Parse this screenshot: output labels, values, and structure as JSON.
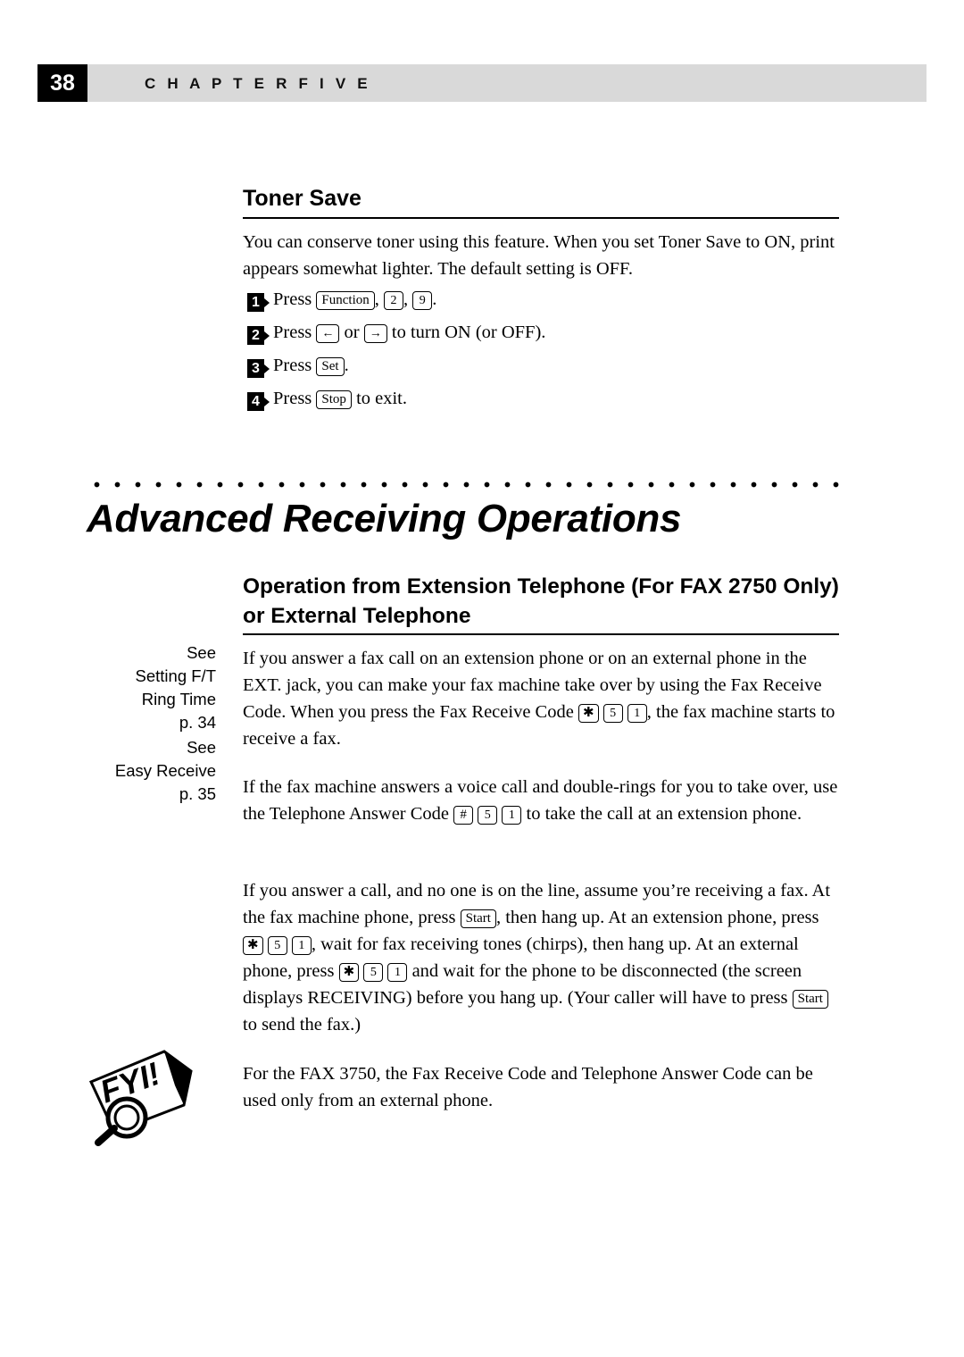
{
  "header": {
    "page_number": "38",
    "chapter_label": "C H A P T E R   F I V E"
  },
  "toner_save": {
    "heading": "Toner Save",
    "intro": "You can conserve toner using this feature.  When you set Toner Save to ON, print appears somewhat lighter.  The default setting is OFF.",
    "steps": [
      {
        "num": "1",
        "pre": "Press",
        "keys": [
          "Function",
          "2",
          "9"
        ],
        "post": "."
      },
      {
        "num": "2",
        "pre": "Press",
        "keys": [
          "←",
          "→"
        ],
        "post": "to turn ON (or OFF)."
      },
      {
        "num": "3",
        "pre": "Press",
        "keys": [
          "Set"
        ],
        "post": "."
      },
      {
        "num": "4",
        "pre": "Press",
        "keys": [
          "Stop"
        ],
        "post": "to exit."
      }
    ],
    "step1_text_a": "Press",
    "step1_key1": "Function",
    "step1_comma1": ",",
    "step1_key2": "2",
    "step1_comma2": ",",
    "step1_key3": "9",
    "step1_period": ".",
    "step2_text_a": "Press",
    "step2_key1": "←",
    "step2_or": "or",
    "step2_key2": "→",
    "step2_text_b": "to turn ON (or OFF).",
    "step3_text_a": "Press",
    "step3_key1": "Set",
    "step3_period": ".",
    "step4_text_a": "Press",
    "step4_key1": "Stop",
    "step4_text_b": "to exit."
  },
  "section": {
    "big_title": "Advanced Receiving Operations",
    "sub_heading_line1": "Operation from Extension Telephone (For FAX 2750 Only)",
    "sub_heading_line2": "or External Telephone"
  },
  "margin_notes": [
    {
      "line1": "See",
      "line2": "Setting F/T",
      "line3": "Ring Time",
      "line4": "p. 34"
    },
    {
      "line1": "See",
      "line2": "Easy Receive",
      "line3": "p. 35"
    }
  ],
  "body": {
    "p1_a": "If you answer a fax call on an extension phone or on an external phone in the EXT.  jack, you can make your fax machine take over by using the Fax Receive Code. When you press the Fax Receive Code",
    "p1_keys": [
      "✱",
      "5",
      "1"
    ],
    "p1_b": ", the fax machine starts to receive a fax.",
    "p2_a": "If the fax machine answers a voice call and double-rings for you to take over, use the Telephone Answer Code",
    "p2_keys": [
      "#",
      "5",
      "1"
    ],
    "p2_b": "to take the call at an extension phone.",
    "p3_a": "If you answer a call, and no one is on the line, assume you’re receiving a fax. At the fax machine phone, press",
    "p3_key_start1": "Start",
    "p3_b": ", then hang up. At an extension phone, press",
    "p3_keys1": [
      "✱",
      "5",
      "1"
    ],
    "p3_c": ", wait for fax receiving tones (chirps), then hang up. At an external phone, press",
    "p3_keys2": [
      "✱",
      "5",
      "1"
    ],
    "p3_d": "and wait for the phone to be disconnected (the screen displays RECEIVING) before you hang up.  (Your caller will have to press",
    "p3_key_start2": "Start",
    "p3_e": "to send the fax.)",
    "p4": "For the FAX 3750, the Fax Receive Code and Telephone Answer Code can be used only from an external phone."
  },
  "icons": {
    "fyi": "FYI!"
  }
}
